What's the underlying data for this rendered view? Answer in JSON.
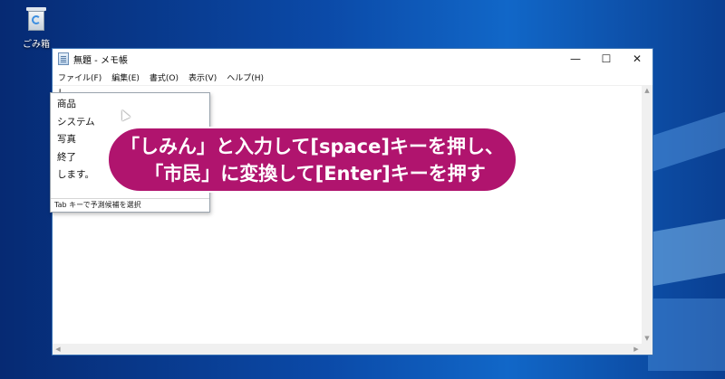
{
  "desktop": {
    "recycle_bin_label": "ごみ箱"
  },
  "window": {
    "title": "無題 - メモ帳",
    "controls": {
      "minimize": "—",
      "maximize": "☐",
      "close": "✕"
    },
    "menu": [
      "ファイル(F)",
      "編集(E)",
      "書式(O)",
      "表示(V)",
      "ヘルプ(H)"
    ],
    "editor_text": "し"
  },
  "ime": {
    "candidates": [
      "商品",
      "システム",
      "写真",
      "終了",
      "します。"
    ],
    "footer": "Tab キーで予測候補を選択"
  },
  "callout": {
    "line1": "「しみん」と入力して[space]キーを押し、",
    "line2": "「市民」に変換して[Enter]キーを押す",
    "color": "#b0146e"
  }
}
